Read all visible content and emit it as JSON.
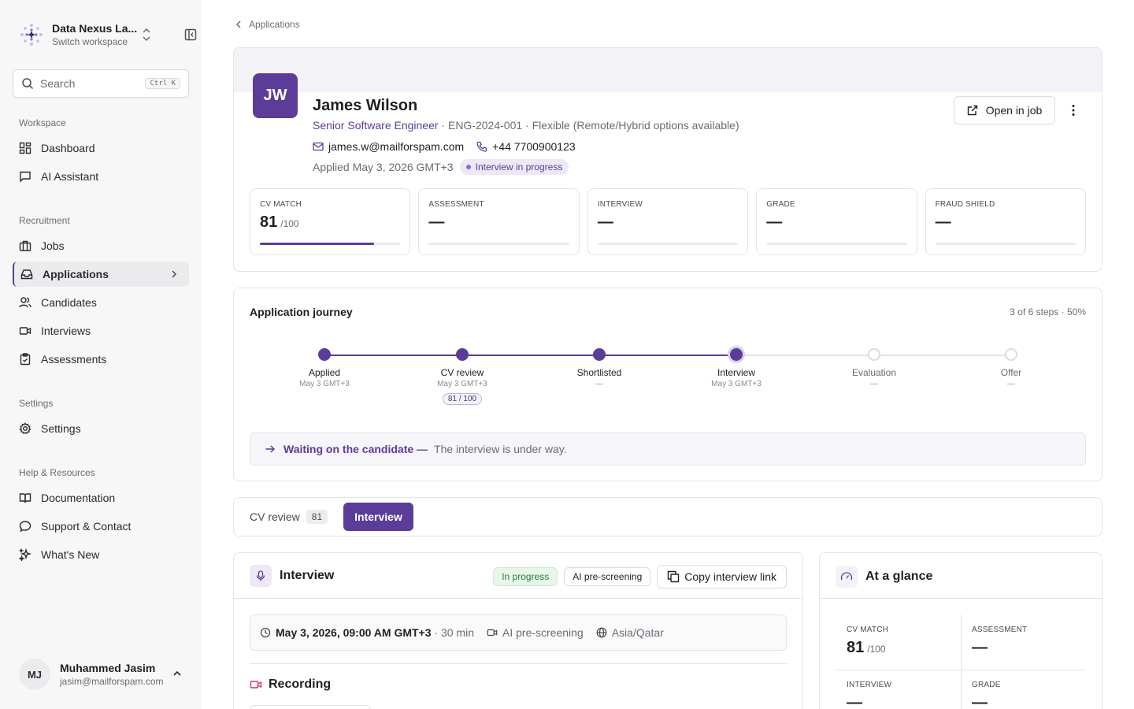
{
  "workspace": {
    "name": "Data Nexus La...",
    "subtitle": "Switch workspace"
  },
  "search": {
    "label": "Search",
    "shortcut": "Ctrl K"
  },
  "nav": {
    "workspace_label": "Workspace",
    "workspace_items": [
      {
        "label": "Dashboard",
        "icon": "dashboard-icon"
      },
      {
        "label": "AI Assistant",
        "icon": "chat-icon"
      }
    ],
    "recruitment_label": "Recruitment",
    "recruitment_items": [
      {
        "label": "Jobs",
        "icon": "briefcase-icon"
      },
      {
        "label": "Applications",
        "icon": "inbox-icon",
        "active": true
      },
      {
        "label": "Candidates",
        "icon": "users-icon"
      },
      {
        "label": "Interviews",
        "icon": "video-icon"
      },
      {
        "label": "Assessments",
        "icon": "clipboard-icon"
      }
    ],
    "settings_label": "Settings",
    "settings_items": [
      {
        "label": "Settings",
        "icon": "gear-icon"
      }
    ],
    "help_label": "Help & Resources",
    "help_items": [
      {
        "label": "Documentation",
        "icon": "book-icon"
      },
      {
        "label": "Support & Contact",
        "icon": "message-icon"
      },
      {
        "label": "What's New",
        "icon": "sparkles-icon"
      }
    ]
  },
  "user": {
    "initials": "MJ",
    "name": "Muhammed Jasim",
    "email": "jasim@mailforspam.com"
  },
  "breadcrumb": {
    "back_label": "Applications"
  },
  "candidate": {
    "initials": "JW",
    "name": "James Wilson",
    "role": "Senior Software Engineer",
    "role_details": " · ENG-2024-001 · Flexible (Remote/Hybrid options available)",
    "email": "james.w@mailforspam.com",
    "phone": "+44 7700900123",
    "applied": "Applied May 3, 2026 GMT+3",
    "status": "Interview in progress",
    "open_label": "Open in job"
  },
  "metrics": [
    {
      "label": "CV MATCH",
      "value": "81",
      "suffix": "/100",
      "progress": 0.81
    },
    {
      "label": "ASSESSMENT",
      "value": "—",
      "suffix": "",
      "progress": 0
    },
    {
      "label": "INTERVIEW",
      "value": "—",
      "suffix": "",
      "progress": 0
    },
    {
      "label": "GRADE",
      "value": "—",
      "suffix": "",
      "progress": 0
    },
    {
      "label": "FRAUD SHIELD",
      "value": "—",
      "suffix": "",
      "progress": 0
    }
  ],
  "journey": {
    "title": "Application journey",
    "progress_text": "3 of 6 steps · 50%",
    "steps": [
      {
        "name": "Applied",
        "date": "May 3 GMT+3",
        "state": "done"
      },
      {
        "name": "CV review",
        "date": "May 3 GMT+3",
        "state": "done",
        "badge": "81 / 100"
      },
      {
        "name": "Shortlisted",
        "date": "—",
        "state": "done"
      },
      {
        "name": "Interview",
        "date": "May 3 GMT+3",
        "state": "current"
      },
      {
        "name": "Evaluation",
        "date": "—",
        "state": "pending"
      },
      {
        "name": "Offer",
        "date": "—",
        "state": "pending"
      }
    ],
    "waiting_title": "Waiting on the candidate —",
    "waiting_text": "The interview is under way."
  },
  "tabs": {
    "cv_label": "CV review",
    "cv_count": "81",
    "interview_label": "Interview"
  },
  "interview": {
    "title": "Interview",
    "status": "In progress",
    "type": "AI pre-screening",
    "copy_label": "Copy interview link",
    "datetime": "May 3, 2026, 09:00 AM GMT+3",
    "duration": "· 30 min",
    "mode": "AI pre-screening",
    "timezone": "Asia/Qatar",
    "recording_label": "Recording"
  },
  "glance": {
    "title": "At a glance",
    "cells": [
      {
        "label": "CV MATCH",
        "value": "81",
        "suffix": "/100"
      },
      {
        "label": "ASSESSMENT",
        "value": "—",
        "suffix": ""
      },
      {
        "label": "INTERVIEW",
        "value": "—",
        "suffix": ""
      },
      {
        "label": "GRADE",
        "value": "—",
        "suffix": ""
      }
    ]
  },
  "colors": {
    "accent": "#5b3d99",
    "accent_light": "#ece8f6",
    "green": "#2e7d32"
  }
}
